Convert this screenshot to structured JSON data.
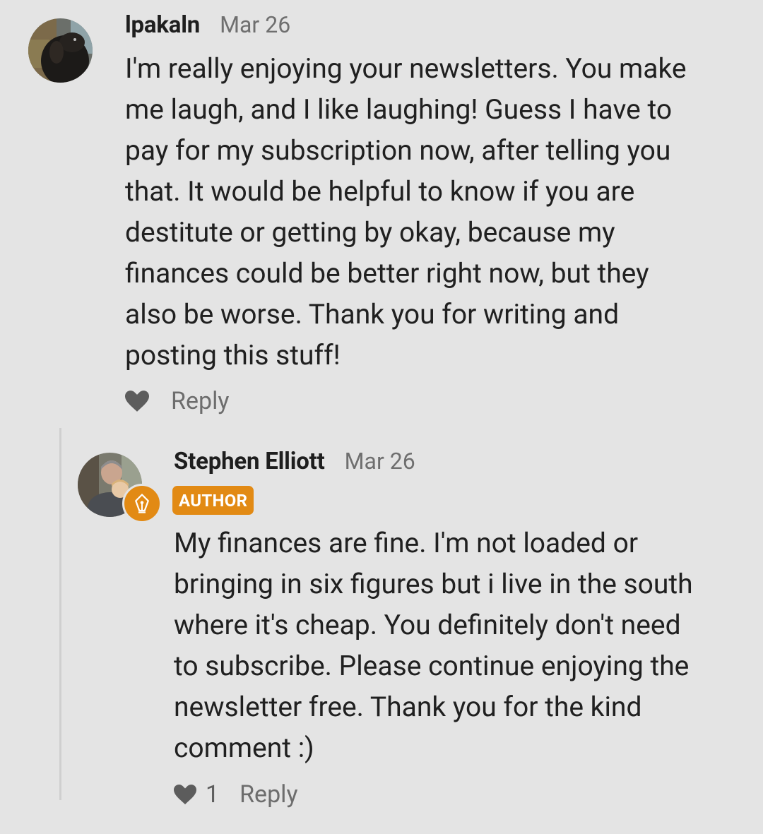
{
  "comments": [
    {
      "username": "lpakaln",
      "date": "Mar 26",
      "avatar_icon": "dog-photo-avatar",
      "body_lines": [
        "I'm really enjoying your newsletters. You make",
        "me laugh, and I like laughing! Guess I have to",
        "pay for my subscription now, after telling you",
        "that. It would be helpful to know if you are",
        "destitute or getting by okay, because my",
        "finances could be better right now, but they",
        "also be worse. Thank you for writing and",
        "posting this stuff!"
      ],
      "like_icon": "heart-icon",
      "reply_label": "Reply"
    },
    {
      "username": "Stephen Elliott",
      "date": "Mar 26",
      "avatar_icon": "person-photo-avatar",
      "badge_icon": "pen-nib-icon",
      "author_tag": "AUTHOR",
      "body_lines": [
        "My finances are fine. I'm not loaded or",
        "bringing in six figures but i live in the south",
        "where it's cheap. You definitely don't need",
        "to subscribe. Please continue enjoying the",
        "newsletter free. Thank you for the kind",
        "comment :)"
      ],
      "like_icon": "heart-icon",
      "like_count": "1",
      "reply_label": "Reply"
    }
  ],
  "colors": {
    "background": "#e4e4e4",
    "author_accent": "#e28a14",
    "text": "#202020",
    "muted": "#6f6f6f"
  }
}
